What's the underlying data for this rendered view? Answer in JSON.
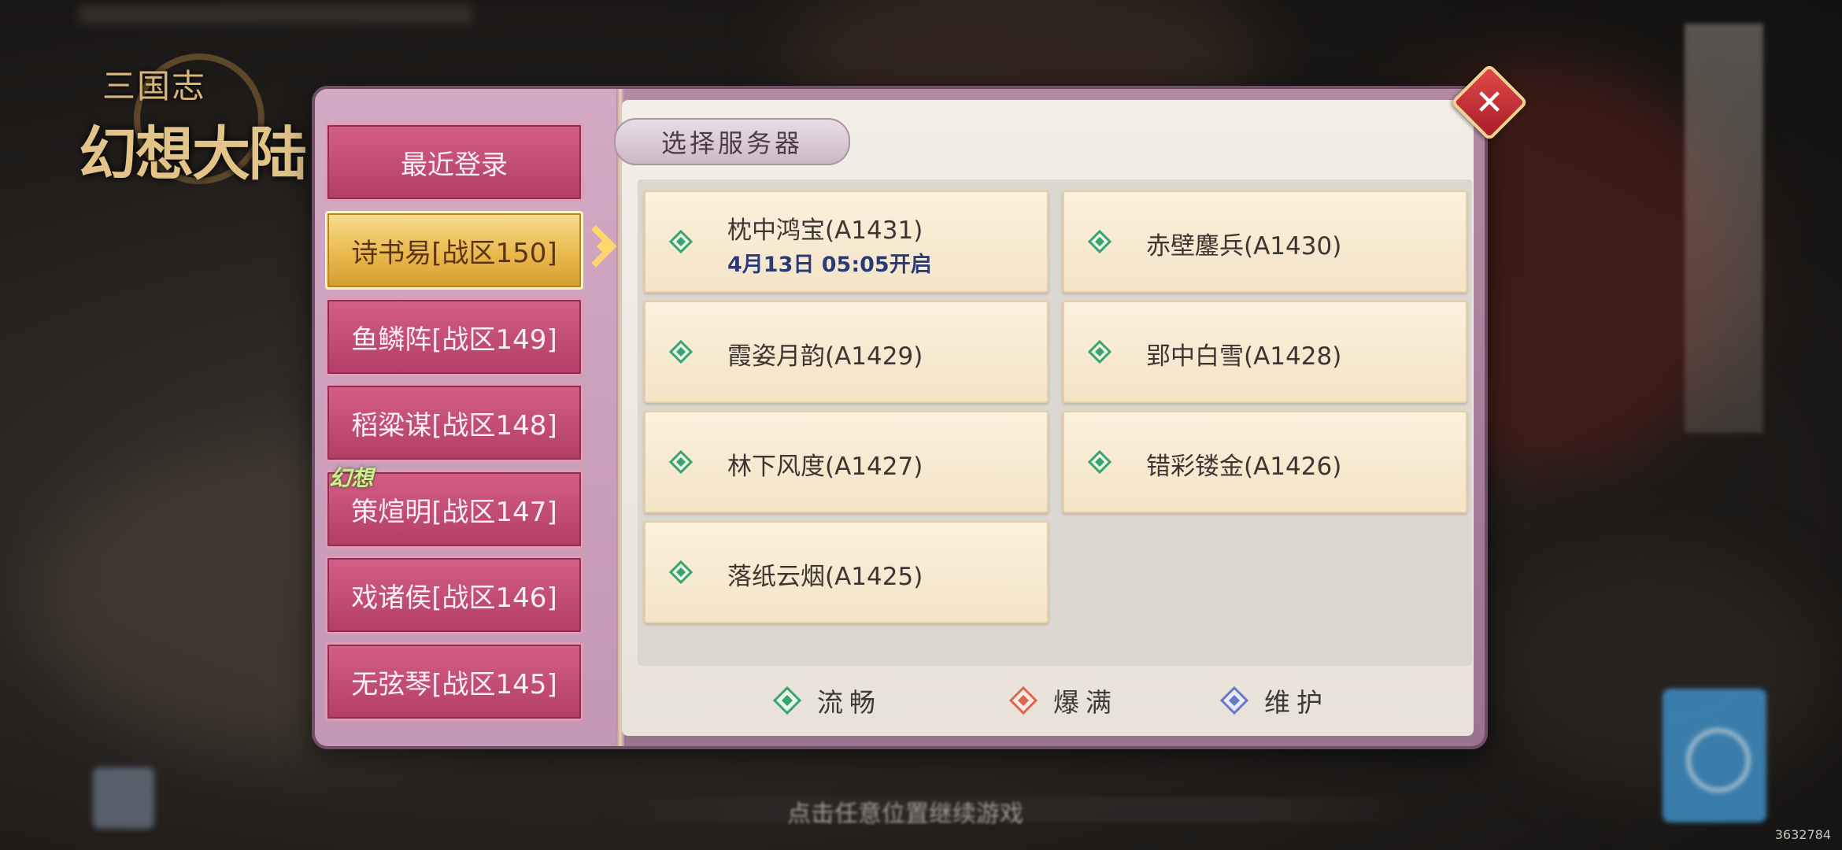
{
  "game": {
    "logo_line1": "三国志",
    "logo_line2": "幻想大陆",
    "tap_hint": "点击任意位置继续游戏",
    "watermark": "3632784"
  },
  "dialog": {
    "title": "选择服务器",
    "close_symbol": "✕",
    "active_tag": "幻想"
  },
  "sidebar": {
    "items": [
      {
        "label": "最近登录",
        "active": false
      },
      {
        "label": "诗书易[战区150]",
        "active": true
      },
      {
        "label": "鱼鳞阵[战区149]",
        "active": false
      },
      {
        "label": "稻粱谋[战区148]",
        "active": false
      },
      {
        "label": "策煊明[战区147]",
        "active": false
      },
      {
        "label": "戏诸侯[战区146]",
        "active": false
      },
      {
        "label": "无弦琴[战区145]",
        "active": false
      }
    ]
  },
  "servers": [
    {
      "name": "枕中鸿宝(A1431)",
      "open_time": "4月13日 05:05开启",
      "status": "smooth"
    },
    {
      "name": "赤壁鏖兵(A1430)",
      "status": "smooth"
    },
    {
      "name": "霞姿月韵(A1429)",
      "status": "smooth"
    },
    {
      "name": "郢中白雪(A1428)",
      "status": "smooth"
    },
    {
      "name": "林下风度(A1427)",
      "status": "smooth"
    },
    {
      "name": "错彩镂金(A1426)",
      "status": "smooth"
    },
    {
      "name": "落纸云烟(A1425)",
      "status": "smooth"
    }
  ],
  "legend": {
    "smooth": "流畅",
    "full": "爆满",
    "maintenance": "维护"
  },
  "colors": {
    "smooth": "#3aa46a",
    "full": "#e0664a",
    "maintenance": "#6a78c8",
    "active_zone": "#e8b549",
    "zone": "#c44a74"
  },
  "icons": {
    "status_dot": "diamond-icon",
    "close": "close-icon",
    "active_pointer": "chevron-right-icon"
  }
}
